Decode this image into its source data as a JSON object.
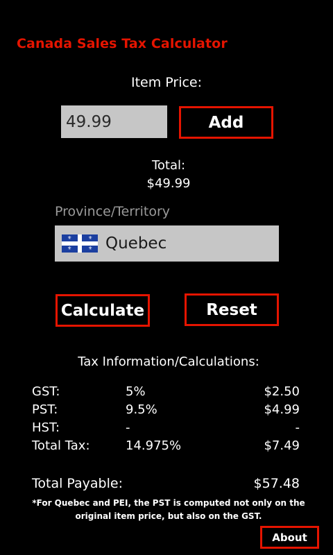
{
  "app": {
    "title": "Canada Sales Tax Calculator"
  },
  "price": {
    "label": "Item Price:",
    "value": "49.99"
  },
  "buttons": {
    "add": "Add",
    "calculate": "Calculate",
    "reset": "Reset",
    "about": "About"
  },
  "total": {
    "label": "Total:",
    "value": "$49.99"
  },
  "province": {
    "label": "Province/Territory",
    "selected": "Quebec",
    "flag_icon": "quebec-flag-icon"
  },
  "tax_info": {
    "heading": "Tax Information/Calculations:",
    "rows": [
      {
        "name": "GST:",
        "rate": "5%",
        "amount": "$2.50"
      },
      {
        "name": "PST:",
        "rate": "9.5%",
        "amount": "$4.99"
      },
      {
        "name": "HST:",
        "rate": "-",
        "amount": "-"
      },
      {
        "name": "Total Tax:",
        "rate": "14.975%",
        "amount": "$7.49"
      }
    ],
    "payable": {
      "name": "Total Payable:",
      "amount": "$57.48"
    }
  },
  "footnote": "*For Quebec and PEI, the PST is computed not only on the original item price, but also on the GST.",
  "colors": {
    "accent": "#e51400",
    "background": "#000000",
    "input_background": "#c6c6c6"
  }
}
